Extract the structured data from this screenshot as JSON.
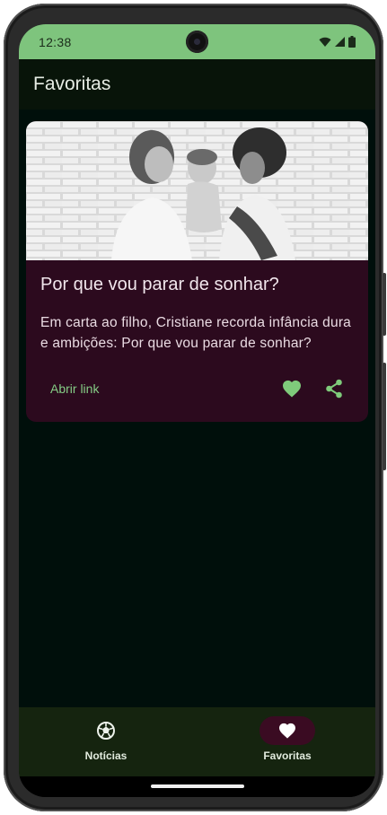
{
  "status_bar": {
    "time": "12:38",
    "icons": [
      "wifi-icon",
      "signal-icon",
      "battery-icon"
    ],
    "color": "#7ec47d"
  },
  "top_bar": {
    "title": "Favoritas"
  },
  "card": {
    "image": "photo of two women holding a baby in front of a brick wall (black and white)",
    "title": "Por que vou parar de sonhar?",
    "description": "Em carta ao filho, Cristiane recorda infância dura e ambições: Por que vou parar de sonhar?",
    "link_label": "Abrir link",
    "favorite_icon": "heart-icon",
    "share_icon": "share-icon",
    "accent": "#85cc85",
    "background": "#2c0a1e"
  },
  "bottom_nav": {
    "items": [
      {
        "label": "Notícias",
        "icon": "soccer-ball-icon",
        "active": false
      },
      {
        "label": "Favoritas",
        "icon": "heart-icon",
        "active": true
      }
    ]
  }
}
